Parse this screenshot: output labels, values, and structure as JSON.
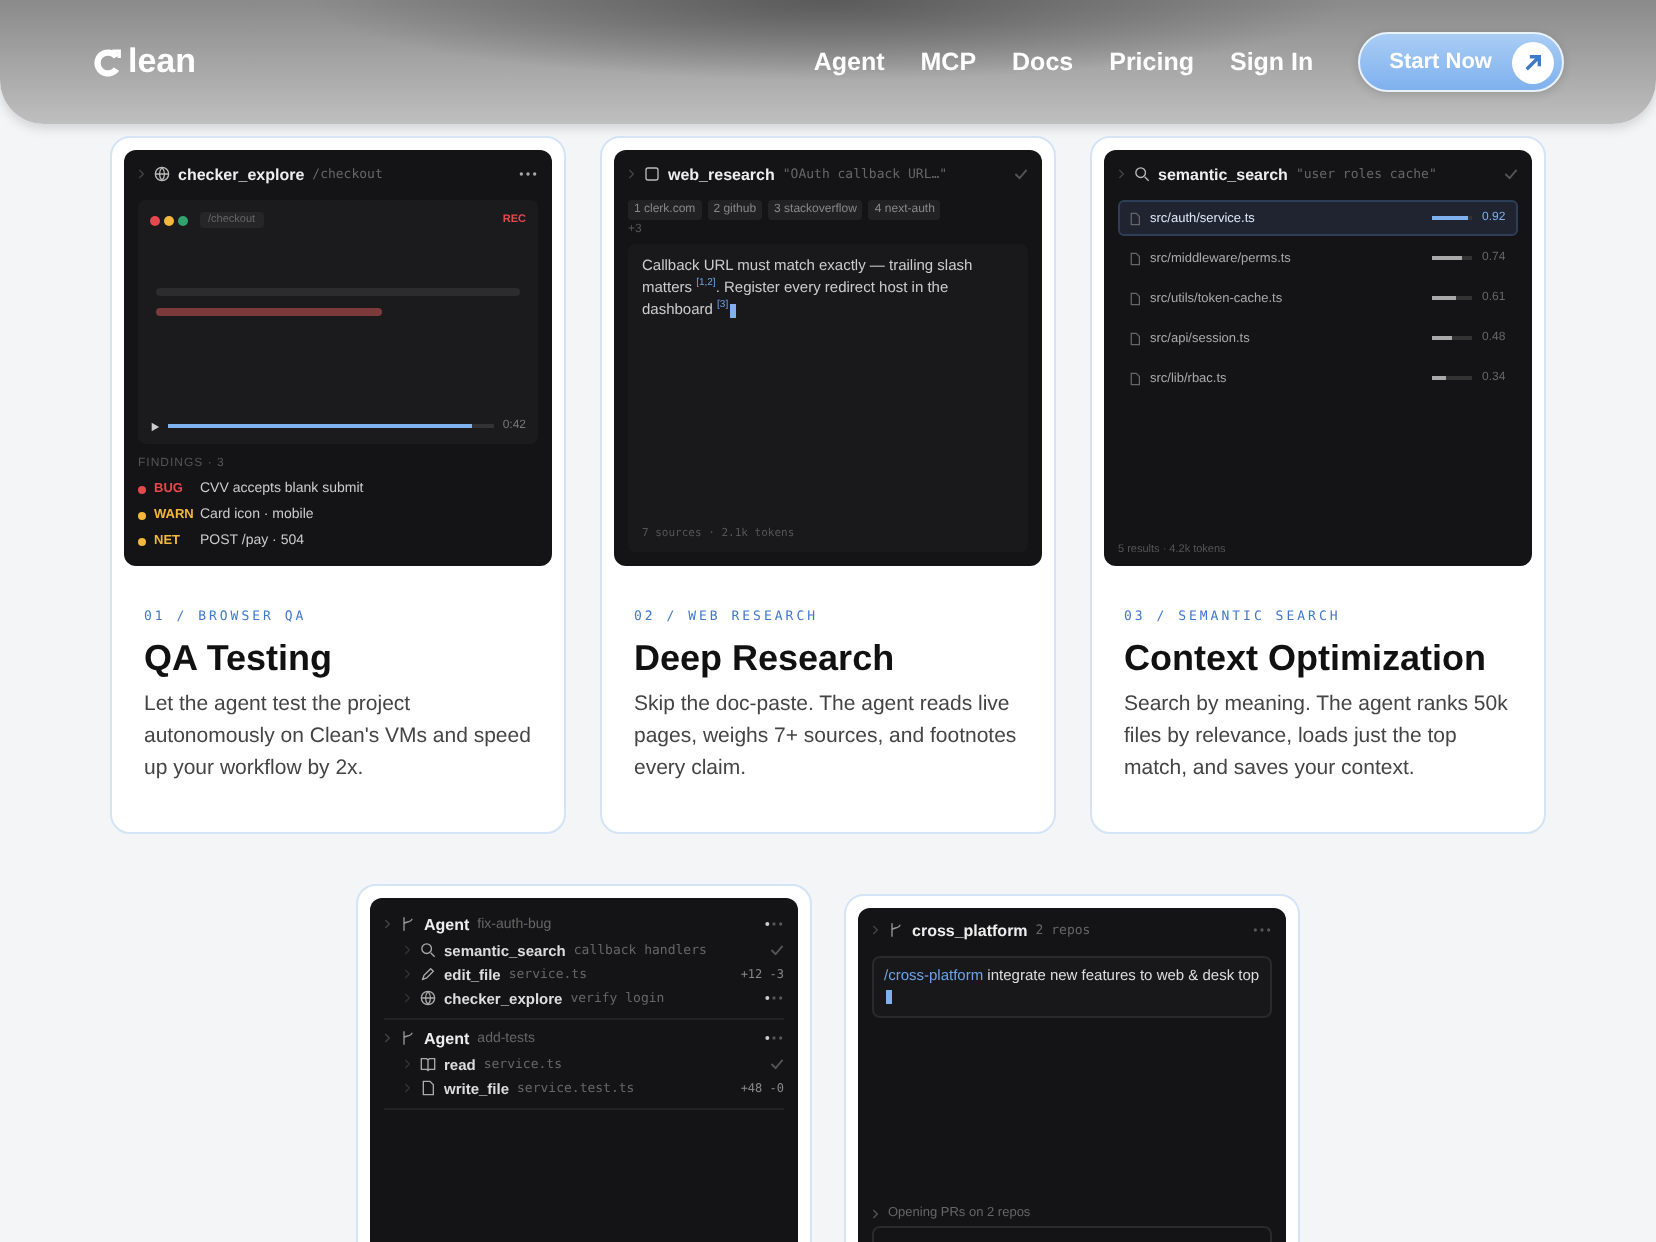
{
  "nav": {
    "logo_text": "lean",
    "links": [
      "Agent",
      "MCP",
      "Docs",
      "Pricing",
      "Sign In"
    ],
    "cta": "Start Now"
  },
  "features": [
    {
      "kind": "browser",
      "panel": {
        "tool": "checker_explore",
        "arg": "/checkout",
        "url": "/checkout",
        "rec": "REC",
        "time": "0:42",
        "level": 0.93,
        "findings_label": "FINDINGS · 3",
        "findings": [
          {
            "tag": "BUG",
            "text": "CVV accepts blank submit",
            "color": "#e5484d"
          },
          {
            "tag": "WARN",
            "text": "Card icon · mobile",
            "color": "#f5b73b"
          },
          {
            "tag": "NET",
            "text": "POST /pay · 504",
            "color": "#f5b73b"
          }
        ]
      },
      "eyebrow": "01 / BROWSER QA",
      "title": "QA Testing",
      "description": "Let the agent test the project autonomously on Clean's VMs and speed up your workflow by 2x."
    },
    {
      "kind": "research",
      "panel": {
        "tool": "web_research",
        "arg": "\"OAuth callback URL…\"",
        "done": true,
        "sources": [
          "1 clerk.com",
          "2 github",
          "3 stackoverflow",
          "4 next-auth"
        ],
        "more": "+3",
        "answer": "Callback URL must match exactly — trailing slash matters $^{[1,2]}$. Register every redirect host in the dashboard $^{[3]}$",
        "footer": "7 sources · 2.1k tokens"
      },
      "eyebrow": "02 / WEB RESEARCH",
      "title": "Deep Research",
      "description": "Skip the doc-paste. The agent reads live pages, weighs 7+ sources, and footnotes every claim."
    },
    {
      "kind": "search",
      "panel": {
        "tool": "semantic_search",
        "arg": "\"user roles cache\"",
        "done": true,
        "results": [
          {
            "path": "src/auth/service.ts",
            "score": "0.92",
            "level": 0.92,
            "selected": true
          },
          {
            "path": "src/middleware/perms.ts",
            "score": "0.74",
            "level": 0.74,
            "selected": false
          },
          {
            "path": "src/utils/token-cache.ts",
            "score": "0.61",
            "level": 0.61,
            "selected": false
          },
          {
            "path": "src/api/session.ts",
            "score": "0.48",
            "level": 0.48,
            "selected": false
          },
          {
            "path": "src/lib/rbac.ts",
            "score": "0.34",
            "level": 0.34,
            "selected": false
          }
        ],
        "footer": "5 results · 4.2k tokens"
      },
      "eyebrow": "03 / SEMANTIC SEARCH",
      "title": "Context Optimization",
      "description": "Search by meaning. The agent ranks 50k files by relevance, loads just the top match, and saves your context."
    }
  ],
  "agents": {
    "groups": [
      {
        "label": "Agent",
        "branch": "fix-auth-bug",
        "running": true,
        "steps": [
          {
            "kind": "search",
            "name": "semantic_search",
            "arg": "callback handlers",
            "done": true
          },
          {
            "kind": "edit",
            "name": "edit_file",
            "arg": "service.ts",
            "diff": "+12 -3"
          },
          {
            "kind": "browse",
            "name": "checker_explore",
            "arg": "verify login",
            "done": false
          }
        ]
      },
      {
        "label": "Agent",
        "branch": "add-tests",
        "running": true,
        "steps": [
          {
            "kind": "read",
            "name": "read",
            "arg": "service.ts",
            "done": true
          },
          {
            "kind": "write",
            "name": "write_file",
            "arg": "service.test.ts",
            "diff": "+48 -0"
          }
        ]
      }
    ]
  },
  "cross": {
    "tool": "cross_platform",
    "arg": "2 repos",
    "command": "/cross-platform",
    "prompt": "integrate new features to web & desk top",
    "status": "Opening PRs on 2 repos"
  }
}
